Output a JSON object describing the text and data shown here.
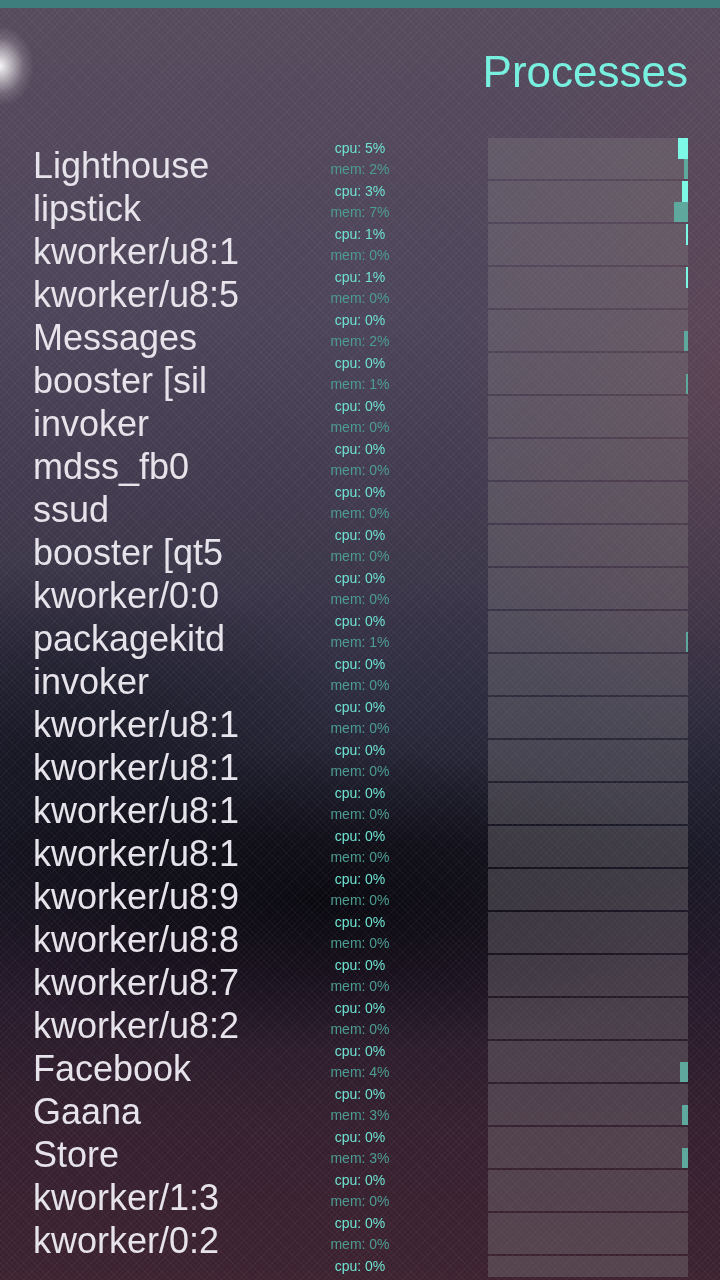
{
  "header": {
    "title": "Processes"
  },
  "processes": [
    {
      "name": "Lighthouse",
      "cpu": {
        "reading": "cpu: 5%",
        "level": 0.05
      },
      "mem": {
        "reading": "mem: 2%",
        "level": 0.02
      }
    },
    {
      "name": "lipstick",
      "cpu": {
        "reading": "cpu: 3%",
        "level": 0.03
      },
      "mem": {
        "reading": "mem: 7%",
        "level": 0.07
      }
    },
    {
      "name": "kworker/u8:1",
      "cpu": {
        "reading": "cpu: 1%",
        "level": 0.01
      },
      "mem": {
        "reading": "mem: 0%"
      }
    },
    {
      "name": "kworker/u8:5",
      "cpu": {
        "reading": "cpu: 1%",
        "level": 0.01
      },
      "mem": {
        "reading": "mem: 0%"
      }
    },
    {
      "name": "Messages",
      "cpu": {
        "reading": "cpu: 0%"
      },
      "mem": {
        "reading": "mem: 2%",
        "level": 0.02
      }
    },
    {
      "name": "booster [sil",
      "cpu": {
        "reading": "cpu: 0%"
      },
      "mem": {
        "reading": "mem: 1%",
        "level": 0.01
      }
    },
    {
      "name": "invoker",
      "cpu": {
        "reading": "cpu: 0%"
      },
      "mem": {
        "reading": "mem: 0%"
      }
    },
    {
      "name": "mdss_fb0",
      "cpu": {
        "reading": "cpu: 0%"
      },
      "mem": {
        "reading": "mem: 0%"
      }
    },
    {
      "name": "ssud",
      "cpu": {
        "reading": "cpu: 0%"
      },
      "mem": {
        "reading": "mem: 0%"
      }
    },
    {
      "name": "booster [qt5",
      "cpu": {
        "reading": "cpu: 0%"
      },
      "mem": {
        "reading": "mem: 0%"
      }
    },
    {
      "name": "kworker/0:0",
      "cpu": {
        "reading": "cpu: 0%"
      },
      "mem": {
        "reading": "mem: 0%"
      }
    },
    {
      "name": "packagekitd",
      "cpu": {
        "reading": "cpu: 0%"
      },
      "mem": {
        "reading": "mem: 1%",
        "level": 0.01
      }
    },
    {
      "name": "invoker",
      "cpu": {
        "reading": "cpu: 0%"
      },
      "mem": {
        "reading": "mem: 0%"
      }
    },
    {
      "name": "kworker/u8:1",
      "cpu": {
        "reading": "cpu: 0%"
      },
      "mem": {
        "reading": "mem: 0%"
      }
    },
    {
      "name": "kworker/u8:1",
      "cpu": {
        "reading": "cpu: 0%"
      },
      "mem": {
        "reading": "mem: 0%"
      }
    },
    {
      "name": "kworker/u8:1",
      "cpu": {
        "reading": "cpu: 0%"
      },
      "mem": {
        "reading": "mem: 0%"
      }
    },
    {
      "name": "kworker/u8:1",
      "cpu": {
        "reading": "cpu: 0%"
      },
      "mem": {
        "reading": "mem: 0%"
      }
    },
    {
      "name": "kworker/u8:9",
      "cpu": {
        "reading": "cpu: 0%"
      },
      "mem": {
        "reading": "mem: 0%"
      }
    },
    {
      "name": "kworker/u8:8",
      "cpu": {
        "reading": "cpu: 0%"
      },
      "mem": {
        "reading": "mem: 0%"
      }
    },
    {
      "name": "kworker/u8:7",
      "cpu": {
        "reading": "cpu: 0%"
      },
      "mem": {
        "reading": "mem: 0%"
      }
    },
    {
      "name": "kworker/u8:2",
      "cpu": {
        "reading": "cpu: 0%"
      },
      "mem": {
        "reading": "mem: 0%"
      }
    },
    {
      "name": "Facebook",
      "cpu": {
        "reading": "cpu: 0%"
      },
      "mem": {
        "reading": "mem: 4%",
        "level": 0.04
      }
    },
    {
      "name": "Gaana",
      "cpu": {
        "reading": "cpu: 0%"
      },
      "mem": {
        "reading": "mem: 3%",
        "level": 0.03
      }
    },
    {
      "name": "Store",
      "cpu": {
        "reading": "cpu: 0%"
      },
      "mem": {
        "reading": "mem: 3%",
        "level": 0.03
      }
    },
    {
      "name": "kworker/1:3",
      "cpu": {
        "reading": "cpu: 0%"
      },
      "mem": {
        "reading": "mem: 0%"
      }
    },
    {
      "name": "kworker/0:2",
      "cpu": {
        "reading": "cpu: 0%"
      },
      "mem": {
        "reading": "mem: 0%"
      }
    },
    {
      "cpu": {
        "reading": "cpu: 0%"
      }
    }
  ]
}
